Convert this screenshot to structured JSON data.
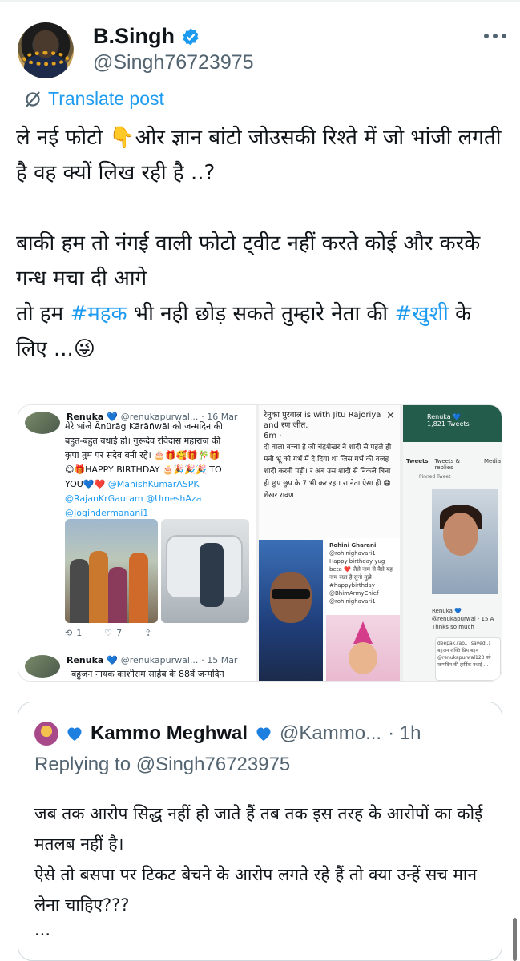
{
  "post": {
    "author": {
      "display_name": "B.Singh",
      "handle": "@Singh76723975",
      "verified": true
    },
    "translate_label": "Translate post",
    "text": {
      "line1_a": "ले नई फोटो ",
      "line1_emoji": "👇",
      "line1_b": "ओर ज्ञान बांटो जोउसकी रिश्ते में जो भांजी लगती है वह क्यों लिख रही है ..?",
      "para2_a": "बाकी हम तो नंगई वाली फोटो ट्वीट नहीं करते कोई और करके गन्ध मचा दी आगे",
      "para2_b_pre": "तो हम ",
      "hashtag1": "#महक",
      "para2_b_mid": " भी नही छोड़ सकते तुम्हारे नेता की ",
      "hashtag2": "#खुशी",
      "para2_b_post": " के लिए ...",
      "end_emoji": "😜"
    }
  },
  "media": {
    "panel_a": {
      "author": "Renuka",
      "handle": "@renukapurwal...",
      "date": "· 16 Mar",
      "text_lines": [
        "मेरे भांजे Ãnürãg Kãrãñwãl को जन्मदिन की",
        "बहुत-बहुत बधाई हो। गुरूदेव रविदास महाराज की",
        "कृपा तुम पर सदेव बनी रहे। 🎂🎁🥰🎁🎋🎁",
        "😊🎁HAPPY BIRTHDAY 🎂🎉🎉🎉 TO",
        "YOU💙❤️ "
      ],
      "links": [
        "@ManishKumarASPK",
        "@RajanKrGautam",
        "@UmeshAza",
        "@Jogindermanani1"
      ],
      "retweets": "1",
      "likes": "7",
      "author2": "Renuka",
      "handle2": "@renukapurwal...",
      "date2": "· 15 Mar",
      "text2": "बहुजन नायक काशीराम साहेब के 88वें जन्मदिन"
    },
    "panel_b": {
      "head": "रेनुका पुरवाल is with Jitu Rajoriya and रण जीत.",
      "time": "6m · ",
      "text": "दो वाला बच्चा है जो चंद्रशेखर ने शादी से पहले ही मनी भ्रू को गर्भ में दे दिया था जिस गर्भ की वजह शादी करनी पड़ी। र अब उस शादी से निकले बिना ही छुप छुप के 7 भी कर रहा। रा नेता ऐसा ही 😀 शेखर रावण",
      "card_name": "Rohini Gharani",
      "card_handle": "@rohinighavari1",
      "card_text": "Happy birthday yug beta ❤️ जैसे नाम से वैसे यह नाम रखा है सुनो मुझे #happybirthday @BhimArmyChief @rohinighavari1"
    },
    "panel_c": {
      "title": "Renuka 💙",
      "tweets": "1,821 Tweets",
      "tabs": [
        "Tweets",
        "Tweets & replies",
        "Media"
      ],
      "pinned": "Pinned Tweet",
      "reply": "Renuka 💙 @renukapurwal · 15 A Thnks so much",
      "card": "deepak.rao.. (saved..) बहुजन शक्ति प्रिय बहन @renukapurwal123 को जन्मदिन की हार्दिक बधाई ..."
    }
  },
  "quote": {
    "avatar_heart": "💙",
    "name": "Kammo Meghwal",
    "name_heart": "💙",
    "handle": "@Kammo...",
    "time": "· 1h",
    "replying_prefix": "Replying to ",
    "replying_to": "@Singh76723975",
    "text": "जब तक आरोप सिद्ध नहीं हो जाते हैं तब तक इस तरह के आरोपों का कोई मतलब नहीं है।\nऐसे तो बसपा पर टिकट बेचने के आरोप लगते रहे हैं तो क्या उन्हें सच मान लेना चाहिए???",
    "ellipsis": "..."
  },
  "colors": {
    "accent": "#1d9bf0",
    "text": "#0f1419",
    "muted": "#536471",
    "border": "#cfd9de"
  }
}
